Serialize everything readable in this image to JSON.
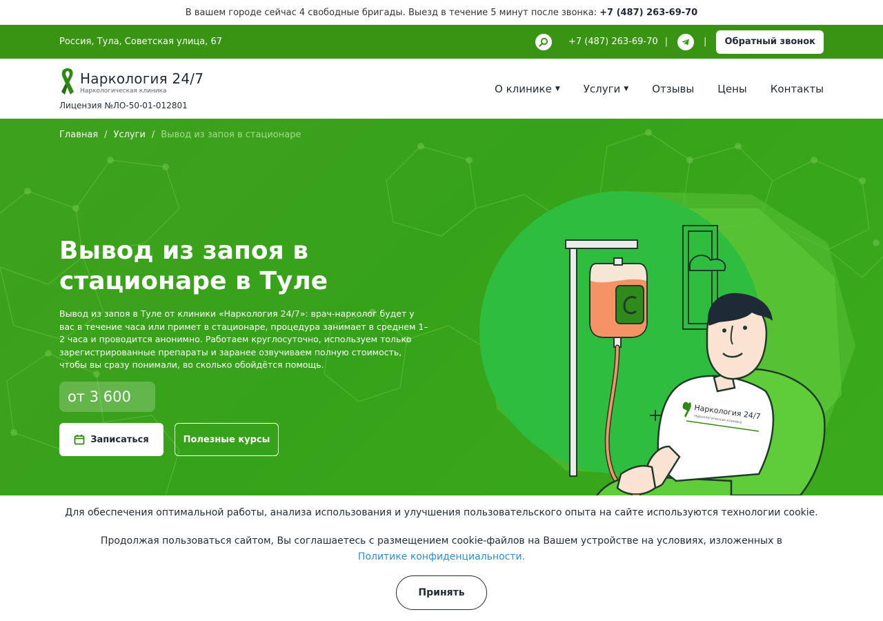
{
  "announce": {
    "text": "В вашем городе сейчас 4 свободные бригады. Выезд в течение 5 минут после звонка:",
    "phone": "+7 (487) 263-69-70"
  },
  "topbar": {
    "address": "Россия, Тула, Советская улица, 67",
    "phone": "+7 (487) 263-69-70",
    "separator": "|",
    "callback_label": "Обратный звонок",
    "search_icon": "search-icon",
    "telegram_icon": "telegram-icon"
  },
  "header": {
    "logo_name": "Наркология 24/7",
    "logo_sub": "Наркологическая клиника",
    "license": "Лицензия №ЛО-50-01-012801",
    "nav": [
      {
        "label": "О клинике",
        "caret": "▼"
      },
      {
        "label": "Услуги",
        "caret": "▼"
      },
      {
        "label": "Отзывы"
      },
      {
        "label": "Цены"
      },
      {
        "label": "Контакты"
      }
    ]
  },
  "hero": {
    "breadcrumbs": [
      "Главная",
      "Услуги",
      "Вывод из запоя в стационаре"
    ],
    "breadcrumb_sep": "/",
    "title": "Вывод из запоя в стационаре в Туле",
    "description": "Вывод из запоя в Туле от клиники «Наркология 24/7»: врач-нарколог будет у вас в течение часа или примет в стационаре, процедура занимает в среднем 1–2 часа и проводится анонимно. Работаем круглосуточно, используем только зарегистрированные препараты и заранее озвучиваем полную стоимость, чтобы вы сразу понимали, во сколько обойдётся помощь.",
    "price": "от 3 600",
    "primary_button": "Записаться",
    "secondary_button": "Полезные курсы",
    "shirt_logo_text": "Наркология 24/7",
    "shirt_logo_sub": "Наркологическая клиника"
  },
  "cookie": {
    "line1": "Для обеспечения оптимальной работы, анализа использования и улучшения пользовательского опыта на сайте используются технологии cookie.",
    "line2": "Продолжая пользоваться сайтом, Вы соглашаетесь с размещением cookie-файлов на Вашем устройстве на условиях, изложенных в",
    "link": "Политике конфиденциальности.",
    "accept_button": "Принять"
  },
  "colors": {
    "brand_green": "#3a9414",
    "hero_green": "#38a21a",
    "link_blue": "#2d8cd9",
    "text_dark": "#1f2a37"
  }
}
